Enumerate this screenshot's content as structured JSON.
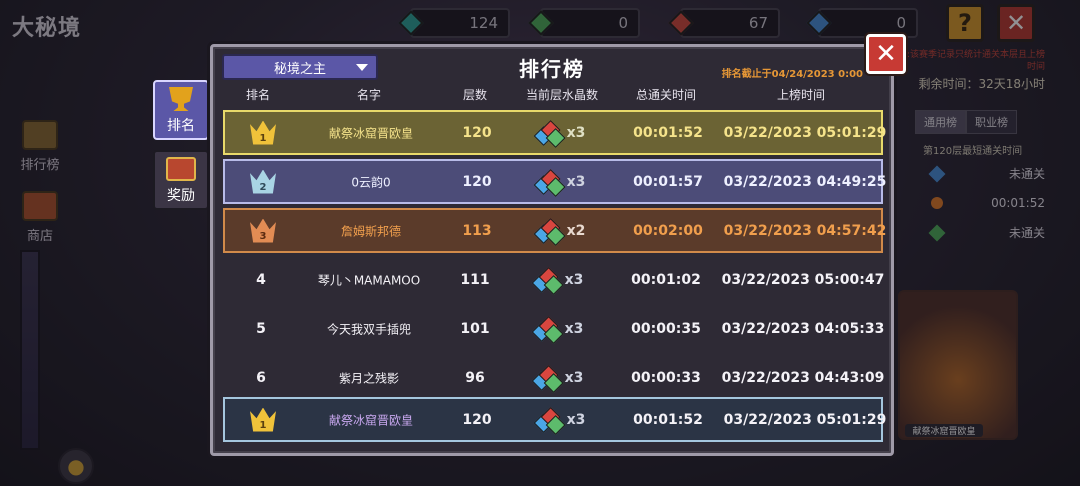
{
  "background": {
    "title": "大秘境",
    "resources": [
      {
        "icon": "teal-crystal-icon",
        "value": "124",
        "color": "#2fa39a"
      },
      {
        "icon": "green-crystal-icon",
        "value": "0",
        "color": "#4fae5c"
      },
      {
        "icon": "red-crystal-icon",
        "value": "67",
        "color": "#d24a3e"
      },
      {
        "icon": "blue-crystal-icon",
        "value": "0",
        "color": "#4a8fd9"
      }
    ],
    "help_label": "?",
    "close_label": "✕",
    "nav": [
      {
        "label": "排行榜",
        "icon": "trophy-icon"
      },
      {
        "label": "商店",
        "icon": "shop-icon"
      }
    ],
    "right_panel": {
      "notice": "注:该赛季记录只统计通关本层且上榜时间",
      "time_left": "剩余时间：32天18小时",
      "tabs": [
        "通用榜",
        "职业榜"
      ],
      "subtitle": "第120层最短通关时间",
      "entries": [
        {
          "icon": "blue-crystal-icon",
          "value": "未通关",
          "color": "#4a8fd9"
        },
        {
          "icon": "fire-icon",
          "value": "00:01:52",
          "color": "#e07a2a"
        },
        {
          "icon": "green-crystal-icon",
          "value": "未通关",
          "color": "#4fae5c"
        }
      ],
      "character_name": "献祭冰窟晋欧皇"
    }
  },
  "modal": {
    "season_select": "秘境之主",
    "title": "排行榜",
    "deadline": "排名截止于04/24/2023 0:00",
    "close_label": "✕",
    "side_tabs": [
      {
        "label": "排名",
        "icon": "trophy-icon",
        "active": true
      },
      {
        "label": "奖励",
        "icon": "treasure-chest-icon",
        "active": false
      }
    ],
    "columns": {
      "rank": "排名",
      "name": "名字",
      "floors": "层数",
      "crystals": "当前层水晶数",
      "total_time": "总通关时间",
      "list_time": "上榜时间"
    },
    "rows": [
      {
        "rank": "1",
        "style": "gold",
        "name": "献祭冰窟晋欧皇",
        "floors": "120",
        "crystals": "x3",
        "total_time": "00:01:52",
        "list_time": "03/22/2023 05:01:29"
      },
      {
        "rank": "2",
        "style": "silver",
        "name": "0云韵0",
        "floors": "120",
        "crystals": "x3",
        "total_time": "00:01:57",
        "list_time": "03/22/2023 04:49:25"
      },
      {
        "rank": "3",
        "style": "bronze",
        "name": "詹姆斯邦德",
        "floors": "113",
        "crystals": "x2",
        "total_time": "00:02:00",
        "list_time": "03/22/2023 04:57:42"
      },
      {
        "rank": "4",
        "style": "plain",
        "name": "琴儿丶MAMAMOO",
        "floors": "111",
        "crystals": "x3",
        "total_time": "00:01:02",
        "list_time": "03/22/2023 05:00:47"
      },
      {
        "rank": "5",
        "style": "plain",
        "name": "今天我双手插兜",
        "floors": "101",
        "crystals": "x3",
        "total_time": "00:00:35",
        "list_time": "03/22/2023 04:05:33"
      },
      {
        "rank": "6",
        "style": "plain",
        "name": "紫月之残影",
        "floors": "96",
        "crystals": "x3",
        "total_time": "00:00:33",
        "list_time": "03/22/2023 04:43:09"
      }
    ],
    "my_row": {
      "rank": "1",
      "style": "gold",
      "name": "献祭冰窟晋欧皇",
      "floors": "120",
      "crystals": "x3",
      "total_time": "00:01:52",
      "list_time": "03/22/2023 05:01:29"
    }
  }
}
